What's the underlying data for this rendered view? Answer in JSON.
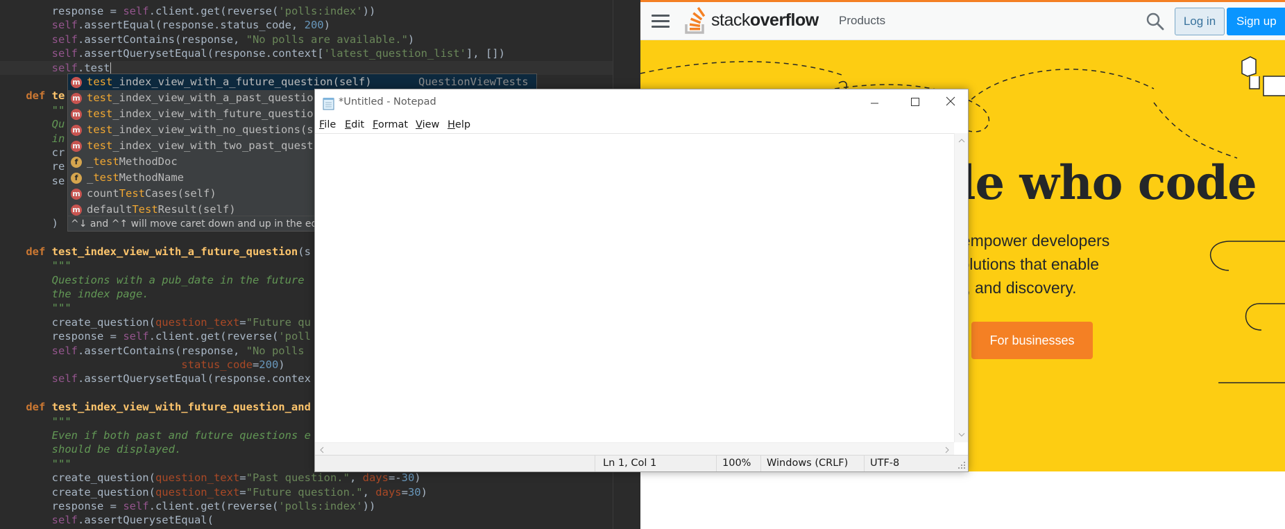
{
  "ide": {
    "code_lines": [
      {
        "segments": [
          {
            "t": "        response = ",
            "c": ""
          },
          {
            "t": "self",
            "c": "self"
          },
          {
            "t": ".client.get(reverse(",
            "c": ""
          },
          {
            "t": "'polls:index'",
            "c": "str"
          },
          {
            "t": "))",
            "c": ""
          }
        ]
      },
      {
        "segments": [
          {
            "t": "        ",
            "c": ""
          },
          {
            "t": "self",
            "c": "self"
          },
          {
            "t": ".assertEqual(response.status_code, ",
            "c": ""
          },
          {
            "t": "200",
            "c": "num"
          },
          {
            "t": ")",
            "c": ""
          }
        ]
      },
      {
        "segments": [
          {
            "t": "        ",
            "c": ""
          },
          {
            "t": "self",
            "c": "self"
          },
          {
            "t": ".assertContains(response, ",
            "c": ""
          },
          {
            "t": "\"No polls are available.\"",
            "c": "str"
          },
          {
            "t": ")",
            "c": ""
          }
        ]
      },
      {
        "segments": [
          {
            "t": "        ",
            "c": ""
          },
          {
            "t": "self",
            "c": "self"
          },
          {
            "t": ".assertQuerysetEqual(response.context[",
            "c": ""
          },
          {
            "t": "'latest_question_list'",
            "c": "str"
          },
          {
            "t": "], [])",
            "c": ""
          }
        ]
      },
      {
        "current": true,
        "caret": true,
        "segments": [
          {
            "t": "        ",
            "c": ""
          },
          {
            "t": "self",
            "c": "self"
          },
          {
            "t": ".test",
            "c": ""
          }
        ]
      },
      {
        "segments": []
      },
      {
        "segments": [
          {
            "t": "    ",
            "c": ""
          },
          {
            "t": "def ",
            "c": "kw"
          },
          {
            "t": "te",
            "c": "fn"
          }
        ]
      },
      {
        "segments": [
          {
            "t": "        \"\"",
            "c": "doc"
          }
        ]
      },
      {
        "segments": [
          {
            "t": "        Qu",
            "c": "doc"
          }
        ]
      },
      {
        "segments": [
          {
            "t": "        in",
            "c": "doc"
          }
        ]
      },
      {
        "segments": [
          {
            "t": "        cr",
            "c": ""
          }
        ]
      },
      {
        "segments": [
          {
            "t": "        re",
            "c": ""
          }
        ]
      },
      {
        "segments": [
          {
            "t": "        se",
            "c": ""
          }
        ]
      },
      {
        "segments": []
      },
      {
        "segments": []
      },
      {
        "segments": [
          {
            "t": "        )",
            "c": ""
          }
        ]
      },
      {
        "segments": []
      },
      {
        "segments": [
          {
            "t": "    ",
            "c": ""
          },
          {
            "t": "def ",
            "c": "kw"
          },
          {
            "t": "test_index_view_with_a_future_question",
            "c": "fn"
          },
          {
            "t": "(s",
            "c": ""
          }
        ]
      },
      {
        "segments": [
          {
            "t": "        \"\"\"",
            "c": "doc"
          }
        ]
      },
      {
        "segments": [
          {
            "t": "        Questions with a pub_date in the future",
            "c": "doc"
          }
        ]
      },
      {
        "segments": [
          {
            "t": "        the index page.",
            "c": "doc"
          }
        ]
      },
      {
        "segments": [
          {
            "t": "        \"\"\"",
            "c": "doc"
          }
        ]
      },
      {
        "segments": [
          {
            "t": "        create_question(",
            "c": ""
          },
          {
            "t": "question_text",
            "c": "param"
          },
          {
            "t": "=",
            "c": ""
          },
          {
            "t": "\"Future qu",
            "c": "str"
          }
        ]
      },
      {
        "segments": [
          {
            "t": "        response = ",
            "c": ""
          },
          {
            "t": "self",
            "c": "self"
          },
          {
            "t": ".client.get(reverse(",
            "c": ""
          },
          {
            "t": "'poll",
            "c": "str"
          }
        ]
      },
      {
        "segments": [
          {
            "t": "        ",
            "c": ""
          },
          {
            "t": "self",
            "c": "self"
          },
          {
            "t": ".assertContains(response, ",
            "c": ""
          },
          {
            "t": "\"No polls",
            "c": "str"
          }
        ]
      },
      {
        "segments": [
          {
            "t": "                            ",
            "c": ""
          },
          {
            "t": "status_code",
            "c": "param"
          },
          {
            "t": "=",
            "c": ""
          },
          {
            "t": "200",
            "c": "num"
          },
          {
            "t": ")",
            "c": ""
          }
        ]
      },
      {
        "segments": [
          {
            "t": "        ",
            "c": ""
          },
          {
            "t": "self",
            "c": "self"
          },
          {
            "t": ".assertQuerysetEqual(response.contex",
            "c": ""
          }
        ]
      },
      {
        "segments": []
      },
      {
        "segments": [
          {
            "t": "    ",
            "c": ""
          },
          {
            "t": "def ",
            "c": "kw"
          },
          {
            "t": "test_index_view_with_future_question_and",
            "c": "fn"
          }
        ]
      },
      {
        "segments": [
          {
            "t": "        \"\"\"",
            "c": "doc"
          }
        ]
      },
      {
        "segments": [
          {
            "t": "        Even if both past and future questions e",
            "c": "doc"
          }
        ]
      },
      {
        "segments": [
          {
            "t": "        should be displayed.",
            "c": "doc"
          }
        ]
      },
      {
        "segments": [
          {
            "t": "        \"\"\"",
            "c": "doc"
          }
        ]
      },
      {
        "segments": [
          {
            "t": "        create_question(",
            "c": ""
          },
          {
            "t": "question_text",
            "c": "param"
          },
          {
            "t": "=",
            "c": ""
          },
          {
            "t": "\"Past question.\"",
            "c": "str"
          },
          {
            "t": ", ",
            "c": ""
          },
          {
            "t": "days",
            "c": "param"
          },
          {
            "t": "=-",
            "c": ""
          },
          {
            "t": "30",
            "c": "num"
          },
          {
            "t": ")",
            "c": ""
          }
        ]
      },
      {
        "segments": [
          {
            "t": "        create_question(",
            "c": ""
          },
          {
            "t": "question_text",
            "c": "param"
          },
          {
            "t": "=",
            "c": ""
          },
          {
            "t": "\"Future question.\"",
            "c": "str"
          },
          {
            "t": ", ",
            "c": ""
          },
          {
            "t": "days",
            "c": "param"
          },
          {
            "t": "=",
            "c": ""
          },
          {
            "t": "30",
            "c": "num"
          },
          {
            "t": ")",
            "c": ""
          }
        ]
      },
      {
        "segments": [
          {
            "t": "        response = ",
            "c": ""
          },
          {
            "t": "self",
            "c": "self"
          },
          {
            "t": ".client.get(reverse(",
            "c": ""
          },
          {
            "t": "'polls:index'",
            "c": "str"
          },
          {
            "t": "))",
            "c": ""
          }
        ]
      },
      {
        "segments": [
          {
            "t": "        ",
            "c": ""
          },
          {
            "t": "self",
            "c": "self"
          },
          {
            "t": ".assertQuerysetEqual(",
            "c": ""
          }
        ]
      }
    ],
    "completion": {
      "items": [
        {
          "badge": "m",
          "prefix": "",
          "match": "test",
          "rest": "_index_view_with_a_future_question(self)",
          "type": "QuestionViewTests"
        },
        {
          "badge": "m",
          "prefix": "",
          "match": "test",
          "rest": "_index_view_with_a_past_questio",
          "type": ""
        },
        {
          "badge": "m",
          "prefix": "",
          "match": "test",
          "rest": "_index_view_with_future_questio",
          "type": ""
        },
        {
          "badge": "m",
          "prefix": "",
          "match": "test",
          "rest": "_index_view_with_no_questions(s",
          "type": ""
        },
        {
          "badge": "m",
          "prefix": "",
          "match": "test",
          "rest": "_index_view_with_two_past_quest",
          "type": ""
        },
        {
          "badge": "f",
          "prefix": "_",
          "match": "test",
          "rest": "MethodDoc",
          "type": ""
        },
        {
          "badge": "f",
          "prefix": "_",
          "match": "test",
          "rest": "MethodName",
          "type": ""
        },
        {
          "badge": "m",
          "prefix": "count",
          "match": "Test",
          "rest": "Cases(self)",
          "type": ""
        },
        {
          "badge": "m",
          "prefix": "default",
          "match": "Test",
          "rest": "Result(self)",
          "type": ""
        }
      ],
      "hint": "^↓ and ^↑ will move caret down and up in the ed"
    }
  },
  "stackoverflow": {
    "logo_text_light": "stack",
    "logo_text_bold": "overflow",
    "products": "Products",
    "login": "Log in",
    "signup": "Sign up",
    "headline": "le who code",
    "subtext": [
      "t empower developers",
      "solutions that enable",
      "th, and discovery."
    ],
    "business_button": "For businesses",
    "colors": {
      "hero_bg": "#fdcd12",
      "brand_orange": "#f48024",
      "signup_blue": "#0a95ff"
    }
  },
  "notepad": {
    "title": "*Untitled - Notepad",
    "menus": [
      {
        "underline": "F",
        "rest": "ile"
      },
      {
        "underline": "E",
        "rest": "dit"
      },
      {
        "underline": "F",
        "rest": "ormat"
      },
      {
        "underline": "V",
        "rest": "iew"
      },
      {
        "underline": "H",
        "rest": "elp"
      }
    ],
    "content": "",
    "status": {
      "position": "Ln 1, Col 1",
      "zoom": "100%",
      "line_endings": "Windows (CRLF)",
      "encoding": "UTF-8"
    }
  }
}
